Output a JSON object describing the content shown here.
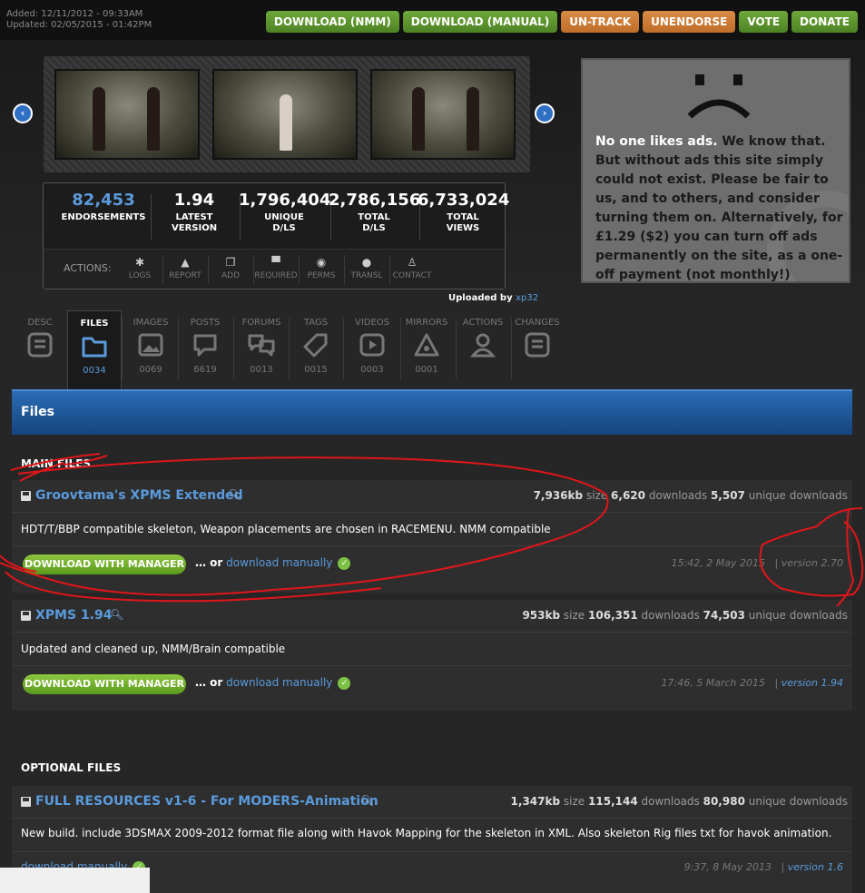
{
  "meta": {
    "added": "Added: 12/11/2012 - 09:33AM",
    "updated": "Updated: 02/05/2015 - 01:42PM"
  },
  "top_buttons": [
    {
      "label": "DOWNLOAD (NMM)",
      "color": "green"
    },
    {
      "label": "DOWNLOAD (MANUAL)",
      "color": "green"
    },
    {
      "label": "UN-TRACK",
      "color": "orange"
    },
    {
      "label": "UNENDORSE",
      "color": "orange"
    },
    {
      "label": "VOTE",
      "color": "green"
    },
    {
      "label": "DONATE",
      "color": "green"
    }
  ],
  "stats": [
    {
      "value": "82,453",
      "label": "ENDORSEMENTS"
    },
    {
      "value": "1.94",
      "label": "LATEST VERSION"
    },
    {
      "value": "1,796,404",
      "label": "UNIQUE D/LS"
    },
    {
      "value": "2,786,156",
      "label": "TOTAL D/LS"
    },
    {
      "value": "6,733,024",
      "label": "TOTAL VIEWS"
    }
  ],
  "actions": {
    "label": "ACTIONS:",
    "items": [
      "LOGS",
      "REPORT",
      "ADD",
      "REQUIRED",
      "PERMS",
      "TRANSL",
      "CONTACT"
    ]
  },
  "uploaded": {
    "prefix": "Uploaded by",
    "user": "xp32"
  },
  "ad": {
    "bold": "No one likes ads.",
    "rest": " We know that. But without ads this site simply could not exist. Please be fair to us, and to others, and consider turning  them on. Alternatively, for £1.29 ($2) you can turn off ads permanently on the site, as a one-off payment (not monthly!)"
  },
  "tabs": [
    {
      "label": "DESC",
      "count": ""
    },
    {
      "label": "FILES",
      "count": "0034"
    },
    {
      "label": "IMAGES",
      "count": "0069"
    },
    {
      "label": "POSTS",
      "count": "6619"
    },
    {
      "label": "FORUMS",
      "count": "0013"
    },
    {
      "label": "TAGS",
      "count": "0015"
    },
    {
      "label": "VIDEOS",
      "count": "0003"
    },
    {
      "label": "MIRRORS",
      "count": "0001"
    },
    {
      "label": "ACTIONS",
      "count": ""
    },
    {
      "label": "CHANGES",
      "count": ""
    }
  ],
  "files_header": "Files",
  "sections": {
    "main": "MAIN FILES",
    "optional": "OPTIONAL FILES"
  },
  "files": [
    {
      "name": "Groovtama's XPMS Extended",
      "size": "7,936kb",
      "size_lbl": "size",
      "downloads": "6,620",
      "downloads_lbl": "downloads",
      "unique": "5,507",
      "unique_lbl": "unique downloads",
      "desc": "HDT/T/BBP compatible skeleton, Weapon placements are chosen in RACEMENU. NMM compatible",
      "button": "DOWNLOAD WITH MANAGER",
      "or": "… or",
      "manual": "download manually",
      "date": "15:42, 2 May 2015",
      "sep": "|",
      "version": "version 2.70"
    },
    {
      "name": "XPMS 1.94",
      "size": "953kb",
      "size_lbl": "size",
      "downloads": "106,351",
      "downloads_lbl": "downloads",
      "unique": "74,503",
      "unique_lbl": "unique downloads",
      "desc": "Updated and cleaned up, NMM/Brain compatible",
      "button": "DOWNLOAD WITH MANAGER",
      "or": "… or",
      "manual": "download manually",
      "date": "17:46, 5 March 2015",
      "sep": "|",
      "version": "version 1.94"
    },
    {
      "name": "FULL RESOURCES v1-6 - For MODERS-Animation",
      "size": "1,347kb",
      "size_lbl": "size",
      "downloads": "115,144",
      "downloads_lbl": "downloads",
      "unique": "80,980",
      "unique_lbl": "unique downloads",
      "desc": "New build. include 3DSMAX 2009-2012 format file along with Havok Mapping for the skeleton in XML. Also skeleton Rig files txt for havok animation.",
      "manual": "download manually",
      "date": "9:37, 8 May 2013",
      "sep": "|",
      "version": "version 1.6"
    }
  ]
}
